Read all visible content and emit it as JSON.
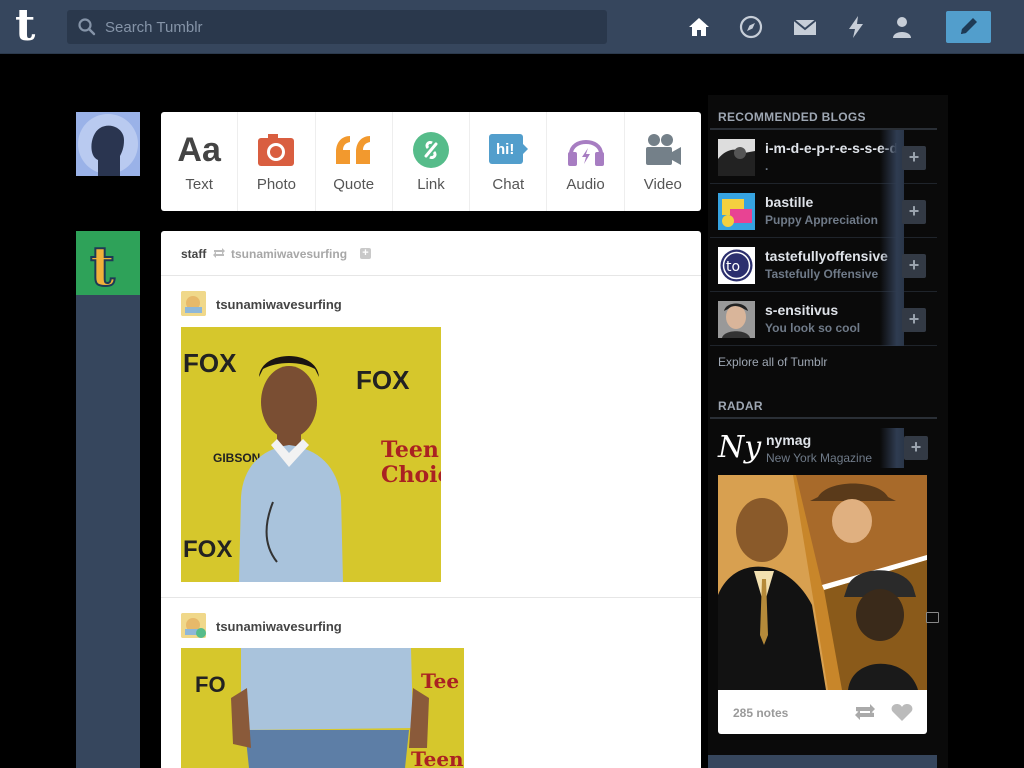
{
  "search": {
    "placeholder": "Search Tumblr"
  },
  "nav": {
    "icons": [
      "home-icon",
      "explore-icon",
      "inbox-icon",
      "activity-icon",
      "account-icon",
      "compose-icon"
    ]
  },
  "post_types": [
    {
      "label": "Text",
      "icon": "text-icon",
      "color": "#444444"
    },
    {
      "label": "Photo",
      "icon": "photo-icon",
      "color": "#d95e40"
    },
    {
      "label": "Quote",
      "icon": "quote-icon",
      "color": "#f2992e"
    },
    {
      "label": "Link",
      "icon": "link-icon",
      "color": "#56bc8a"
    },
    {
      "label": "Chat",
      "icon": "chat-icon",
      "color": "#529ecc"
    },
    {
      "label": "Audio",
      "icon": "audio-icon",
      "color": "#a77dc2"
    },
    {
      "label": "Video",
      "icon": "video-icon",
      "color": "#748089"
    }
  ],
  "post": {
    "reblogger": "staff",
    "source": "tsunamiwavesurfing",
    "entries": [
      {
        "username": "tsunamiwavesurfing"
      },
      {
        "username": "tsunamiwavesurfing"
      }
    ]
  },
  "sidebar": {
    "recommended_title": "RECOMMENDED BLOGS",
    "blogs": [
      {
        "name": "i-m-d-e-p-r-e-s-s-e-d",
        "desc": "."
      },
      {
        "name": "bastille",
        "desc": "Puppy Appreciation"
      },
      {
        "name": "tastefullyoffensive",
        "desc": "Tastefully Offensive"
      },
      {
        "name": "s-ensitivus",
        "desc": "You look so cool"
      }
    ],
    "explore_label": "Explore all of Tumblr",
    "radar_title": "RADAR",
    "radar": {
      "name": "nymag",
      "desc": "New York Magazine",
      "logo_text": "Ny",
      "notes": "285 notes"
    }
  },
  "colors": {
    "topbar": "#36465d",
    "accent": "#529ecc",
    "tumblr_green": "#2ea259"
  }
}
